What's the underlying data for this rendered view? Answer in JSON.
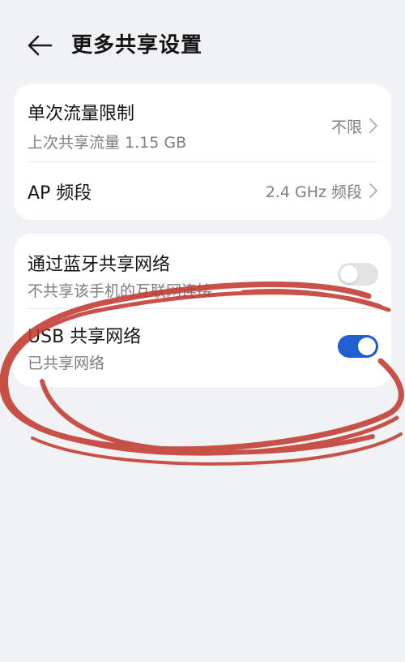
{
  "header": {
    "title": "更多共享设置"
  },
  "card1": {
    "items": [
      {
        "label": "单次流量限制",
        "sub": "上次共享流量 1.15 GB",
        "value": "不限"
      },
      {
        "label": "AP 频段",
        "value": "2.4 GHz 频段"
      }
    ]
  },
  "card2": {
    "items": [
      {
        "label": "通过蓝牙共享网络",
        "sub": "不共享该手机的互联网连接",
        "toggle": false
      },
      {
        "label": "USB 共享网络",
        "sub": "已共享网络",
        "toggle": true
      }
    ]
  },
  "colors": {
    "background": "#f1f2f4",
    "card": "#ffffff",
    "toggle_on": "#1f5fcf",
    "toggle_off": "#e3e3e3",
    "annotation": "#c23a30"
  },
  "icons": {
    "back": "arrow-left-icon",
    "chevron": "chevron-right-icon"
  }
}
